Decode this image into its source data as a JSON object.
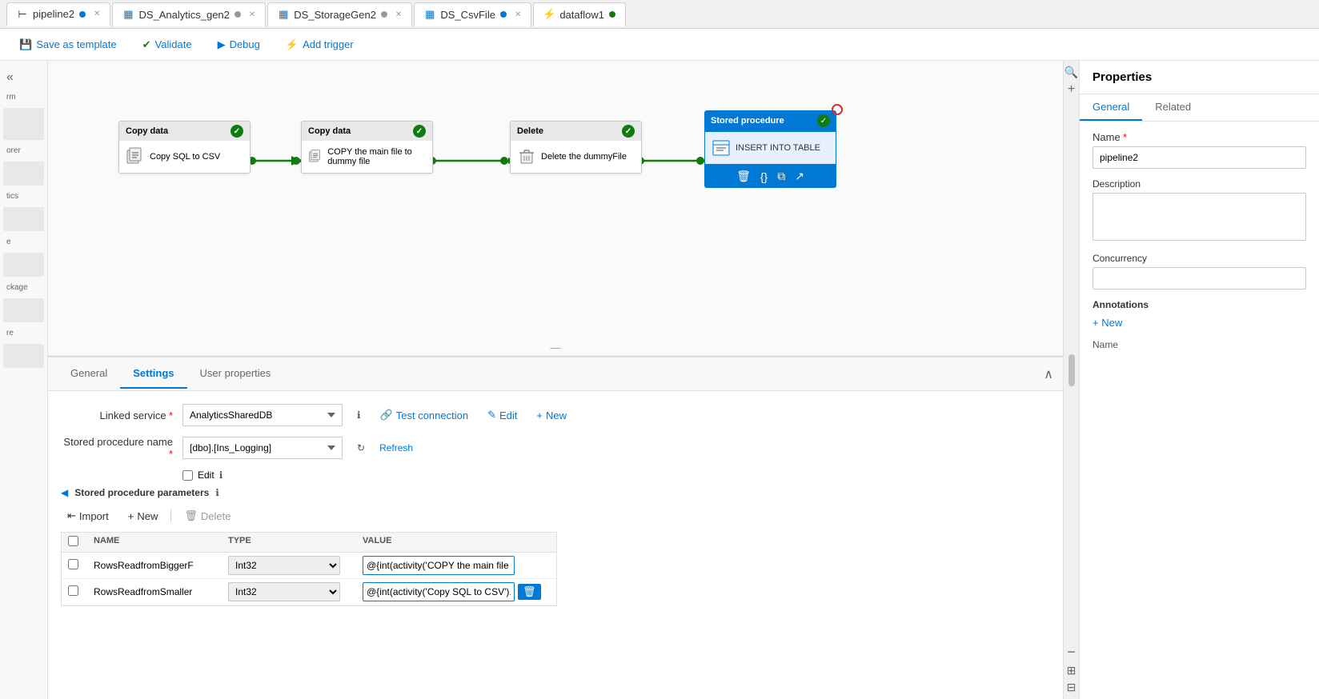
{
  "tabs": [
    {
      "id": "pipeline2",
      "label": "pipeline2",
      "icon": "pipeline",
      "dot_color": "blue",
      "active": true
    },
    {
      "id": "ds_analytics",
      "label": "DS_Analytics_gen2",
      "icon": "dataset",
      "dot_color": "gray"
    },
    {
      "id": "ds_storage",
      "label": "DS_StorageGen2",
      "icon": "dataset",
      "dot_color": "gray"
    },
    {
      "id": "ds_csvfile",
      "label": "DS_CsvFile",
      "icon": "dataset",
      "dot_color": "blue"
    },
    {
      "id": "dataflow1",
      "label": "dataflow1",
      "icon": "dataflow",
      "dot_color": "green"
    }
  ],
  "toolbar": {
    "save_as_template_label": "Save as template",
    "validate_label": "Validate",
    "debug_label": "Debug",
    "add_trigger_label": "Add trigger"
  },
  "canvas": {
    "activities": [
      {
        "id": "copy_data_1",
        "type": "Copy data",
        "name": "Copy SQL to CSV",
        "status": "success"
      },
      {
        "id": "copy_data_2",
        "type": "Copy data",
        "name": "COPY the main file to dummy file",
        "status": "success"
      },
      {
        "id": "delete_1",
        "type": "Delete",
        "name": "Delete the dummyFile",
        "status": "success"
      },
      {
        "id": "stored_proc_1",
        "type": "Stored procedure",
        "name": "INSERT INTO TABLE",
        "status": "active"
      }
    ]
  },
  "bottom_panel": {
    "tabs": [
      {
        "id": "general",
        "label": "General",
        "active": false
      },
      {
        "id": "settings",
        "label": "Settings",
        "active": true
      },
      {
        "id": "user_properties",
        "label": "User properties",
        "active": false
      }
    ],
    "settings": {
      "linked_service_label": "Linked service",
      "linked_service_required": true,
      "linked_service_value": "AnalyticsSharedDB",
      "linked_service_placeholder": "AnalyticsSharedDB",
      "test_connection_label": "Test connection",
      "edit_label": "Edit",
      "new_label": "New",
      "stored_proc_name_label": "Stored procedure name",
      "stored_proc_name_required": true,
      "stored_proc_name_value": "[dbo].[Ins_Logging]",
      "refresh_label": "Refresh",
      "edit_checkbox_label": "Edit",
      "params_section_label": "Stored procedure parameters",
      "import_label": "Import",
      "new_param_label": "New",
      "delete_label": "Delete",
      "columns": {
        "name": "NAME",
        "type": "TYPE",
        "value": "VALUE"
      },
      "parameters": [
        {
          "name": "RowsReadfromBiggerF",
          "type": "Int32",
          "value": "@{int(activity('COPY the main file to dummy file').output.rowsCopied)}"
        },
        {
          "name": "RowsReadfromSmaller",
          "type": "Int32",
          "value": "@{int(activity('Copy SQL to CSV').output.rowsCopied)}"
        }
      ]
    }
  },
  "right_panel": {
    "title": "Properties",
    "tabs": [
      {
        "id": "general",
        "label": "General",
        "active": true
      },
      {
        "id": "related",
        "label": "Related",
        "active": false
      }
    ],
    "name_label": "Name",
    "name_required": true,
    "name_value": "pipeline2",
    "description_label": "Description",
    "description_value": "",
    "concurrency_label": "Concurrency",
    "concurrency_value": "",
    "annotations_label": "Annotations",
    "add_annotation_label": "+ New",
    "name_column_label": "Name"
  },
  "left_sidebar": {
    "items": [
      {
        "id": "rm",
        "label": "rm"
      },
      {
        "id": "orer",
        "label": "orer"
      },
      {
        "id": "tics",
        "label": "tics"
      },
      {
        "id": "e",
        "label": "e"
      },
      {
        "id": "ckage",
        "label": "ckage"
      },
      {
        "id": "re",
        "label": "re"
      }
    ]
  }
}
